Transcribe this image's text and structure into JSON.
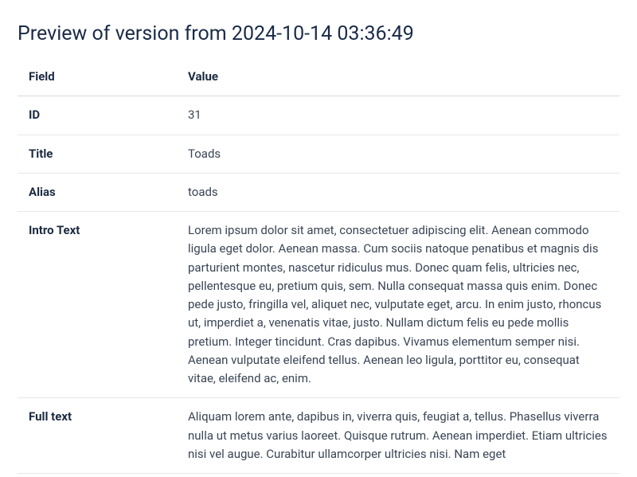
{
  "heading": "Preview of version from 2024-10-14 03:36:49",
  "table": {
    "header_field": "Field",
    "header_value": "Value",
    "rows": {
      "id": {
        "label": "ID",
        "value": "31"
      },
      "title": {
        "label": "Title",
        "value": "Toads"
      },
      "alias": {
        "label": "Alias",
        "value": "toads"
      },
      "introtext": {
        "label": "Intro Text",
        "value": "Lorem ipsum dolor sit amet, consectetuer adipiscing elit. Aenean commodo ligula eget dolor. Aenean massa. Cum sociis natoque penatibus et magnis dis parturient montes, nascetur ridiculus mus. Donec quam felis, ultricies nec, pellentesque eu, pretium quis, sem. Nulla consequat massa quis enim. Donec pede justo, fringilla vel, aliquet nec, vulputate eget, arcu. In enim justo, rhoncus ut, imperdiet a, venenatis vitae, justo. Nullam dictum felis eu pede mollis pretium. Integer tincidunt. Cras dapibus. Vivamus elementum semper nisi. Aenean vulputate eleifend tellus. Aenean leo ligula, porttitor eu, consequat vitae, eleifend ac, enim."
      },
      "fulltext": {
        "label": "Full text",
        "value": "Aliquam lorem ante, dapibus in, viverra quis, feugiat a, tellus. Phasellus viverra nulla ut metus varius laoreet. Quisque rutrum. Aenean imperdiet. Etiam ultricies nisi vel augue. Curabitur ullamcorper ultricies nisi. Nam eget"
      }
    }
  }
}
